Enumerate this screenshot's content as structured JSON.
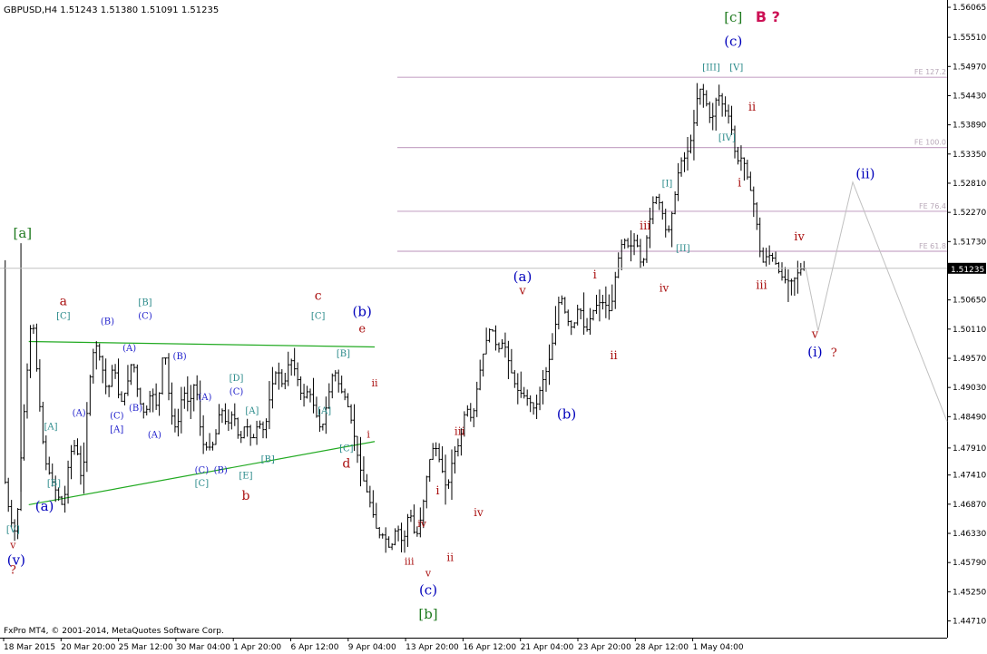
{
  "chart_data": {
    "type": "candlestick",
    "title": "GBPUSD,H4  1.51243 1.51380 1.51091 1.51235",
    "footer": "FxPro MT4, © 2001-2014, MetaQuotes Software Corp.",
    "current_price_label": "1.51235",
    "current_price": 1.51235,
    "ylim": [
      1.444,
      1.562
    ],
    "y_ticks": [
      {
        "value": 1.56065,
        "label": "1.56065"
      },
      {
        "value": 1.5551,
        "label": "1.55510"
      },
      {
        "value": 1.5497,
        "label": "1.54970"
      },
      {
        "value": 1.5443,
        "label": "1.54430"
      },
      {
        "value": 1.5389,
        "label": "1.53890"
      },
      {
        "value": 1.5335,
        "label": "1.53350"
      },
      {
        "value": 1.5281,
        "label": "1.52810"
      },
      {
        "value": 1.5227,
        "label": "1.52270"
      },
      {
        "value": 1.5173,
        "label": "1.51730"
      },
      {
        "value": 1.5065,
        "label": "1.50650"
      },
      {
        "value": 1.5011,
        "label": "1.50110"
      },
      {
        "value": 1.4957,
        "label": "1.49570"
      },
      {
        "value": 1.4903,
        "label": "1.49030"
      },
      {
        "value": 1.4849,
        "label": "1.48490"
      },
      {
        "value": 1.4791,
        "label": "1.47910"
      },
      {
        "value": 1.4741,
        "label": "1.47410"
      },
      {
        "value": 1.4687,
        "label": "1.46870"
      },
      {
        "value": 1.4633,
        "label": "1.46330"
      },
      {
        "value": 1.4579,
        "label": "1.45790"
      },
      {
        "value": 1.4525,
        "label": "1.45250"
      },
      {
        "value": 1.4471,
        "label": "1.44710"
      }
    ],
    "x_ticks": [
      "18 Mar 2015",
      "20 Mar 20:00",
      "25 Mar 12:00",
      "30 Mar 04:00",
      "1 Apr 20:00",
      "6 Apr 12:00",
      "9 Apr 04:00",
      "13 Apr 20:00",
      "16 Apr 12:00",
      "21 Apr 04:00",
      "23 Apr 20:00",
      "28 Apr 12:00",
      "1 May 04:00"
    ],
    "fib_levels": [
      {
        "label": "FE 127.2",
        "value": 1.5477
      },
      {
        "label": "FE 100.0",
        "value": 1.5347
      },
      {
        "label": "FE 76.4",
        "value": 1.5229
      },
      {
        "label": "FE 61.8",
        "value": 1.5155
      }
    ],
    "price_path": [
      [
        0,
        1.475
      ],
      [
        2,
        1.466
      ],
      [
        4,
        1.463
      ],
      [
        6,
        1.482
      ],
      [
        9,
        1.505
      ],
      [
        11,
        1.49
      ],
      [
        13,
        1.477
      ],
      [
        16,
        1.472
      ],
      [
        19,
        1.468
      ],
      [
        21,
        1.478
      ],
      [
        23,
        1.48
      ],
      [
        25,
        1.472
      ],
      [
        27,
        1.49
      ],
      [
        29,
        1.499
      ],
      [
        31,
        1.495
      ],
      [
        33,
        1.489
      ],
      [
        35,
        1.495
      ],
      [
        37,
        1.487
      ],
      [
        39,
        1.49
      ],
      [
        41,
        1.496
      ],
      [
        43,
        1.488
      ],
      [
        45,
        1.485
      ],
      [
        47,
        1.49
      ],
      [
        49,
        1.486
      ],
      [
        51,
        1.499
      ],
      [
        53,
        1.486
      ],
      [
        55,
        1.482
      ],
      [
        57,
        1.49
      ],
      [
        59,
        1.487
      ],
      [
        61,
        1.492
      ],
      [
        63,
        1.48
      ],
      [
        65,
        1.479
      ],
      [
        67,
        1.48
      ],
      [
        69,
        1.487
      ],
      [
        71,
        1.483
      ],
      [
        73,
        1.486
      ],
      [
        75,
        1.48
      ],
      [
        77,
        1.484
      ],
      [
        79,
        1.48
      ],
      [
        81,
        1.484
      ],
      [
        83,
        1.482
      ],
      [
        85,
        1.49
      ],
      [
        87,
        1.494
      ],
      [
        89,
        1.49
      ],
      [
        91,
        1.496
      ],
      [
        93,
        1.493
      ],
      [
        95,
        1.488
      ],
      [
        97,
        1.49
      ],
      [
        99,
        1.486
      ],
      [
        101,
        1.482
      ],
      [
        103,
        1.488
      ],
      [
        105,
        1.494
      ],
      [
        107,
        1.49
      ],
      [
        109,
        1.488
      ],
      [
        111,
        1.483
      ],
      [
        113,
        1.476
      ],
      [
        115,
        1.472
      ],
      [
        117,
        1.468
      ],
      [
        119,
        1.463
      ],
      [
        121,
        1.463
      ],
      [
        123,
        1.46
      ],
      [
        125,
        1.465
      ],
      [
        127,
        1.461
      ],
      [
        129,
        1.468
      ],
      [
        131,
        1.462
      ],
      [
        133,
        1.467
      ],
      [
        135,
        1.476
      ],
      [
        137,
        1.48
      ],
      [
        139,
        1.476
      ],
      [
        141,
        1.471
      ],
      [
        143,
        1.478
      ],
      [
        145,
        1.48
      ],
      [
        147,
        1.487
      ],
      [
        149,
        1.484
      ],
      [
        151,
        1.492
      ],
      [
        153,
        1.498
      ],
      [
        155,
        1.502
      ],
      [
        157,
        1.497
      ],
      [
        159,
        1.499
      ],
      [
        161,
        1.494
      ],
      [
        163,
        1.49
      ],
      [
        165,
        1.489
      ],
      [
        167,
        1.488
      ],
      [
        169,
        1.486
      ],
      [
        171,
        1.491
      ],
      [
        173,
        1.494
      ],
      [
        175,
        1.5
      ],
      [
        177,
        1.508
      ],
      [
        179,
        1.503
      ],
      [
        181,
        1.501
      ],
      [
        183,
        1.506
      ],
      [
        185,
        1.5
      ],
      [
        187,
        1.504
      ],
      [
        189,
        1.506
      ],
      [
        191,
        1.506
      ],
      [
        193,
        1.504
      ],
      [
        195,
        1.513
      ],
      [
        197,
        1.518
      ],
      [
        199,
        1.516
      ],
      [
        201,
        1.518
      ],
      [
        203,
        1.512
      ],
      [
        205,
        1.52
      ],
      [
        207,
        1.526
      ],
      [
        209,
        1.524
      ],
      [
        211,
        1.518
      ],
      [
        213,
        1.524
      ],
      [
        215,
        1.532
      ],
      [
        217,
        1.533
      ],
      [
        219,
        1.537
      ],
      [
        221,
        1.546
      ],
      [
        223,
        1.544
      ],
      [
        225,
        1.539
      ],
      [
        227,
        1.545
      ],
      [
        229,
        1.542
      ],
      [
        231,
        1.54
      ],
      [
        233,
        1.532
      ],
      [
        235,
        1.533
      ],
      [
        237,
        1.528
      ],
      [
        239,
        1.523
      ],
      [
        241,
        1.513
      ],
      [
        243,
        1.515
      ],
      [
        245,
        1.514
      ],
      [
        247,
        1.511
      ],
      [
        249,
        1.51
      ],
      [
        251,
        1.51
      ],
      [
        253,
        1.512
      ],
      [
        254,
        1.5124
      ]
    ],
    "triangle_lines": [
      {
        "name": "upper",
        "points": [
          [
            8,
            1.4988
          ],
          [
            118,
            1.4978
          ]
        ]
      },
      {
        "name": "lower",
        "points": [
          [
            8,
            1.4686
          ],
          [
            118,
            1.4803
          ]
        ]
      }
    ],
    "projection_path": [
      [
        255,
        1.5124
      ],
      [
        259,
        1.5008
      ],
      [
        270,
        1.5283
      ],
      [
        300,
        1.484
      ]
    ],
    "labels": [
      {
        "text": "[a]",
        "x": 6,
        "y": 1.518,
        "color": "#1f7a1f",
        "size": 15
      },
      {
        "text": "[V]",
        "x": 3,
        "y": 1.4635,
        "color": "#2a8a8a",
        "size": 10
      },
      {
        "text": "(v)",
        "x": 4,
        "y": 1.4575,
        "color": "#0000bb",
        "size": 15
      },
      {
        "text": "v",
        "x": 3,
        "y": 1.4605,
        "color": "#aa1111",
        "size": 11
      },
      {
        "text": "?",
        "x": 3,
        "y": 1.4558,
        "color": "#aa1111",
        "size": 13
      },
      {
        "text": "a",
        "x": 19,
        "y": 1.5055,
        "color": "#aa1111",
        "size": 14
      },
      {
        "text": "[C]",
        "x": 19,
        "y": 1.503,
        "color": "#2a8a8a",
        "size": 10
      },
      {
        "text": "[B]",
        "x": 45,
        "y": 1.5055,
        "color": "#2a8a8a",
        "size": 10
      },
      {
        "text": "(C)",
        "x": 45,
        "y": 1.503,
        "color": "#2222cc",
        "size": 10
      },
      {
        "text": "(B)",
        "x": 33,
        "y": 1.502,
        "color": "#2222cc",
        "size": 10
      },
      {
        "text": "(A)",
        "x": 40,
        "y": 1.497,
        "color": "#2222cc",
        "size": 10
      },
      {
        "text": "(B)",
        "x": 56,
        "y": 1.4955,
        "color": "#2222cc",
        "size": 10
      },
      {
        "text": "(A)",
        "x": 24,
        "y": 1.485,
        "color": "#2222cc",
        "size": 10
      },
      {
        "text": "(C)",
        "x": 36,
        "y": 1.4845,
        "color": "#2222cc",
        "size": 10
      },
      {
        "text": "[A]",
        "x": 36,
        "y": 1.482,
        "color": "#2222cc",
        "size": 10
      },
      {
        "text": "(B)",
        "x": 42,
        "y": 1.486,
        "color": "#2222cc",
        "size": 10
      },
      {
        "text": "(A)",
        "x": 48,
        "y": 1.481,
        "color": "#2222cc",
        "size": 10
      },
      {
        "text": "[A]",
        "x": 15,
        "y": 1.4825,
        "color": "#2a8a8a",
        "size": 10
      },
      {
        "text": "[B]",
        "x": 16,
        "y": 1.472,
        "color": "#2a8a8a",
        "size": 10
      },
      {
        "text": "(a)",
        "x": 13,
        "y": 1.4675,
        "color": "#0000bb",
        "size": 15
      },
      {
        "text": "(A)",
        "x": 64,
        "y": 1.488,
        "color": "#2222cc",
        "size": 10
      },
      {
        "text": "(C)",
        "x": 74,
        "y": 1.489,
        "color": "#2222cc",
        "size": 10
      },
      {
        "text": "[D]",
        "x": 74,
        "y": 1.4915,
        "color": "#2a8a8a",
        "size": 10
      },
      {
        "text": "[A]",
        "x": 79,
        "y": 1.4855,
        "color": "#2a8a8a",
        "size": 10
      },
      {
        "text": "[B]",
        "x": 84,
        "y": 1.4765,
        "color": "#2a8a8a",
        "size": 10
      },
      {
        "text": "(C)",
        "x": 63,
        "y": 1.4745,
        "color": "#2222cc",
        "size": 10
      },
      {
        "text": "(B)",
        "x": 69,
        "y": 1.4745,
        "color": "#2222cc",
        "size": 10
      },
      {
        "text": "[C]",
        "x": 63,
        "y": 1.472,
        "color": "#2a8a8a",
        "size": 10
      },
      {
        "text": "[E]",
        "x": 77,
        "y": 1.4735,
        "color": "#2a8a8a",
        "size": 10
      },
      {
        "text": "b",
        "x": 77,
        "y": 1.4695,
        "color": "#aa1111",
        "size": 14
      },
      {
        "text": "c",
        "x": 100,
        "y": 1.5065,
        "color": "#aa1111",
        "size": 14
      },
      {
        "text": "[C]",
        "x": 100,
        "y": 1.503,
        "color": "#2a8a8a",
        "size": 10
      },
      {
        "text": "[B]",
        "x": 108,
        "y": 1.496,
        "color": "#2a8a8a",
        "size": 10
      },
      {
        "text": "[A]",
        "x": 102,
        "y": 1.4855,
        "color": "#2a8a8a",
        "size": 10
      },
      {
        "text": "[C]",
        "x": 109,
        "y": 1.4785,
        "color": "#2a8a8a",
        "size": 10
      },
      {
        "text": "d",
        "x": 109,
        "y": 1.4755,
        "color": "#aa1111",
        "size": 14
      },
      {
        "text": "(b)",
        "x": 114,
        "y": 1.5035,
        "color": "#0000bb",
        "size": 15
      },
      {
        "text": "e",
        "x": 114,
        "y": 1.5005,
        "color": "#aa1111",
        "size": 13
      },
      {
        "text": "ii",
        "x": 118,
        "y": 1.4905,
        "color": "#aa1111",
        "size": 11
      },
      {
        "text": "i",
        "x": 116,
        "y": 1.481,
        "color": "#aa1111",
        "size": 11
      },
      {
        "text": "iii",
        "x": 129,
        "y": 1.4575,
        "color": "#aa1111",
        "size": 11
      },
      {
        "text": "v",
        "x": 135,
        "y": 1.4553,
        "color": "#aa1111",
        "size": 11
      },
      {
        "text": "(c)",
        "x": 135,
        "y": 1.452,
        "color": "#0000bb",
        "size": 15
      },
      {
        "text": "[b]",
        "x": 135,
        "y": 1.4475,
        "color": "#1f7a1f",
        "size": 15
      },
      {
        "text": "iv",
        "x": 133,
        "y": 1.4645,
        "color": "#aa1111",
        "size": 11
      },
      {
        "text": "i",
        "x": 138,
        "y": 1.4705,
        "color": "#aa1111",
        "size": 13
      },
      {
        "text": "ii",
        "x": 142,
        "y": 1.4582,
        "color": "#aa1111",
        "size": 12
      },
      {
        "text": "iii",
        "x": 145,
        "y": 1.4815,
        "color": "#aa1111",
        "size": 12
      },
      {
        "text": "iv",
        "x": 151,
        "y": 1.4665,
        "color": "#aa1111",
        "size": 12
      },
      {
        "text": "(a)",
        "x": 165,
        "y": 1.51,
        "color": "#0000bb",
        "size": 15
      },
      {
        "text": "v",
        "x": 165,
        "y": 1.5075,
        "color": "#aa1111",
        "size": 13
      },
      {
        "text": "(b)",
        "x": 179,
        "y": 1.4845,
        "color": "#0000bb",
        "size": 15
      },
      {
        "text": "i",
        "x": 188,
        "y": 1.5105,
        "color": "#aa1111",
        "size": 13
      },
      {
        "text": "ii",
        "x": 194,
        "y": 1.4955,
        "color": "#aa1111",
        "size": 13
      },
      {
        "text": "iii",
        "x": 204,
        "y": 1.5195,
        "color": "#aa1111",
        "size": 13
      },
      {
        "text": "iv",
        "x": 210,
        "y": 1.508,
        "color": "#aa1111",
        "size": 12
      },
      {
        "text": "[I]",
        "x": 211,
        "y": 1.5275,
        "color": "#2a8a8a",
        "size": 10
      },
      {
        "text": "[II]",
        "x": 216,
        "y": 1.5155,
        "color": "#2a8a8a",
        "size": 10
      },
      {
        "text": "[III]",
        "x": 225,
        "y": 1.549,
        "color": "#2a8a8a",
        "size": 10
      },
      {
        "text": "[IV]",
        "x": 230,
        "y": 1.536,
        "color": "#2a8a8a",
        "size": 10
      },
      {
        "text": "[V]",
        "x": 233,
        "y": 1.549,
        "color": "#2a8a8a",
        "size": 10
      },
      {
        "text": "(c)",
        "x": 232,
        "y": 1.5535,
        "color": "#0000bb",
        "size": 15
      },
      {
        "text": "[c]",
        "x": 232,
        "y": 1.558,
        "color": "#1f7a1f",
        "size": 15
      },
      {
        "text": "ii",
        "x": 238,
        "y": 1.5415,
        "color": "#aa1111",
        "size": 13
      },
      {
        "text": "i",
        "x": 234,
        "y": 1.5275,
        "color": "#aa1111",
        "size": 13
      },
      {
        "text": "iii",
        "x": 241,
        "y": 1.5085,
        "color": "#aa1111",
        "size": 13
      },
      {
        "text": "iv",
        "x": 253,
        "y": 1.5175,
        "color": "#aa1111",
        "size": 13
      },
      {
        "text": "v",
        "x": 258,
        "y": 1.4995,
        "color": "#aa1111",
        "size": 13
      },
      {
        "text": "(i)",
        "x": 258,
        "y": 1.496,
        "color": "#0000bb",
        "size": 15
      },
      {
        "text": "?",
        "x": 264,
        "y": 1.496,
        "color": "#aa1111",
        "size": 13
      },
      {
        "text": "(ii)",
        "x": 274,
        "y": 1.529,
        "color": "#0000bb",
        "size": 15
      }
    ],
    "major_label": {
      "text": "B ?",
      "x": 243,
      "y": 1.558,
      "color": "#cc1155"
    }
  }
}
